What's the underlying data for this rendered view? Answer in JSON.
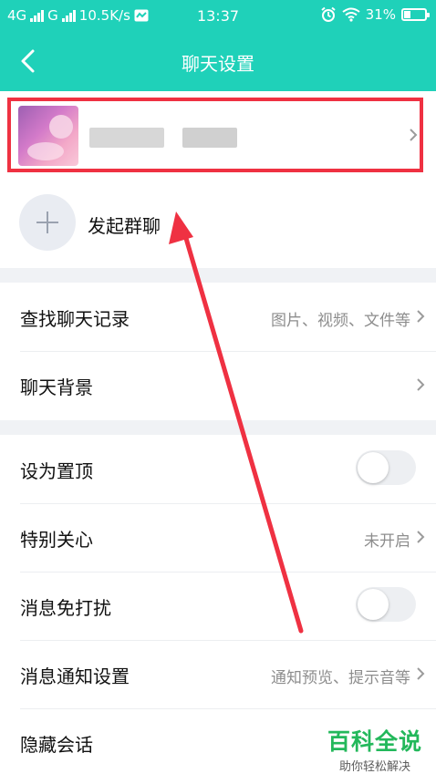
{
  "status_bar": {
    "network1": "4G",
    "network2": "G",
    "speed": "10.5K/s",
    "time": "13:37",
    "battery": "31%",
    "battery_level": 0.31
  },
  "header": {
    "title": "聊天设置"
  },
  "profile": {
    "name": ""
  },
  "actions": {
    "start_group": "发起群聊"
  },
  "rows": [
    {
      "label": "查找聊天记录",
      "value": "图片、视频、文件等"
    },
    {
      "label": "聊天背景",
      "value": ""
    },
    {
      "label": "设为置顶",
      "toggle": false
    },
    {
      "label": "特别关心",
      "value": "未开启"
    },
    {
      "label": "消息免打扰",
      "toggle": false
    },
    {
      "label": "消息通知设置",
      "value": "通知预览、提示音等"
    },
    {
      "label": "隐藏会话"
    }
  ],
  "watermark": {
    "title": "百科全说",
    "subtitle": "助你轻松解决"
  },
  "colors": {
    "header_bg": "#1fd1b9",
    "annotation_red": "#ef3142",
    "watermark_green": "#23b85b"
  }
}
